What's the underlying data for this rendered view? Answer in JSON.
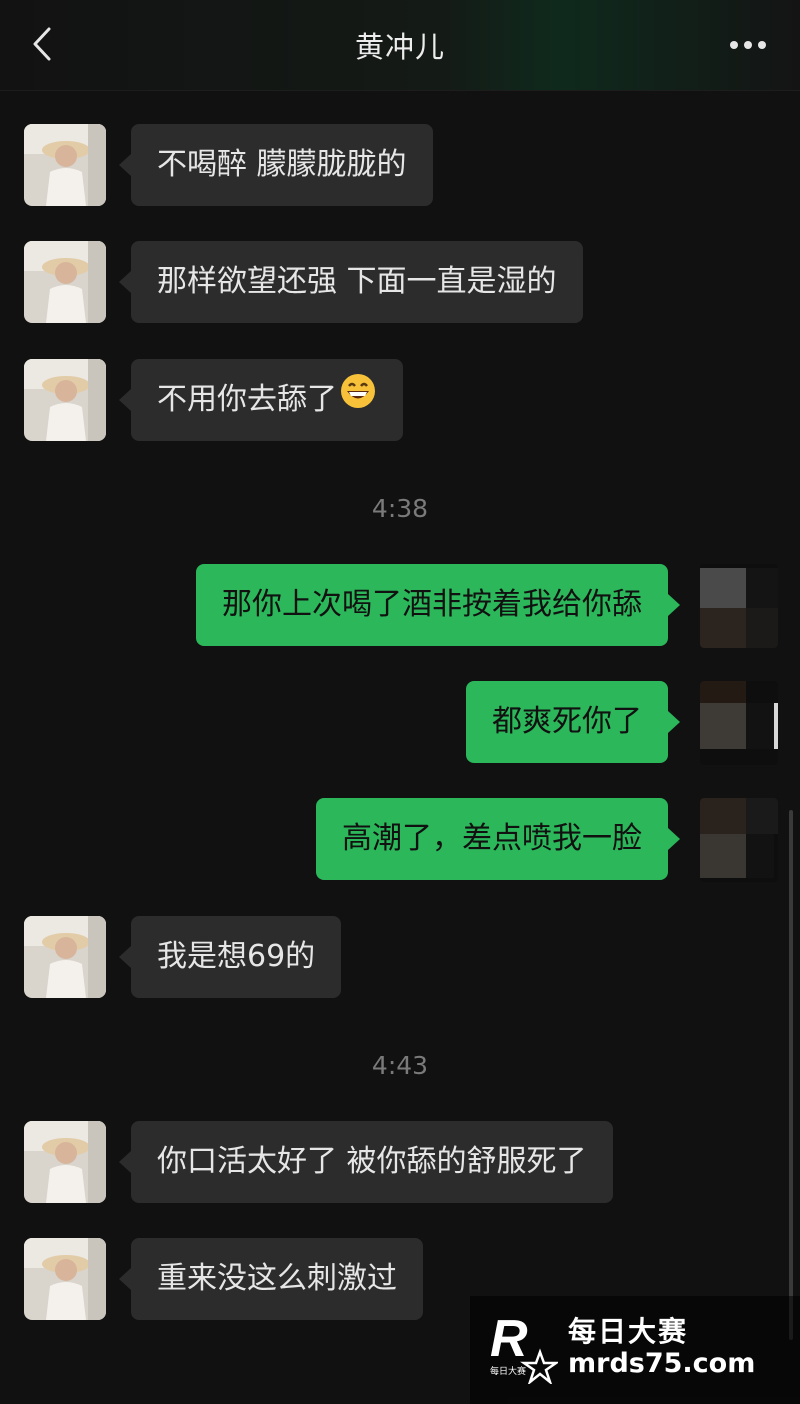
{
  "header": {
    "title": "黄冲儿",
    "back_icon": "chevron-left-icon",
    "more_icon": "more-dots-icon"
  },
  "colors": {
    "background": "#111111",
    "incoming_bubble": "#2c2c2c",
    "outgoing_bubble": "#2bb75a",
    "timestamp": "#7a7a7a"
  },
  "messages": [
    {
      "from": "them",
      "text": "不喝醉 朦朦胧胧的"
    },
    {
      "from": "them",
      "text": "那样欲望还强 下面一直是湿的"
    },
    {
      "from": "them",
      "text": "不用你去舔了",
      "emoji": "grinning-face-icon"
    },
    {
      "time": "4:38"
    },
    {
      "from": "me",
      "text": "那你上次喝了酒非按着我给你舔"
    },
    {
      "from": "me",
      "text": "都爽死你了"
    },
    {
      "from": "me",
      "text": "高潮了，差点喷我一脸"
    },
    {
      "from": "them",
      "text": "我是想69的"
    },
    {
      "time": "4:43"
    },
    {
      "from": "them",
      "text": "你口活太好了 被你舔的舒服死了"
    },
    {
      "from": "them",
      "text": "重来没这么刺激过"
    }
  ],
  "watermark": {
    "name": "每日大赛",
    "url": "mrds75.com",
    "logo_text": "每日大赛"
  }
}
